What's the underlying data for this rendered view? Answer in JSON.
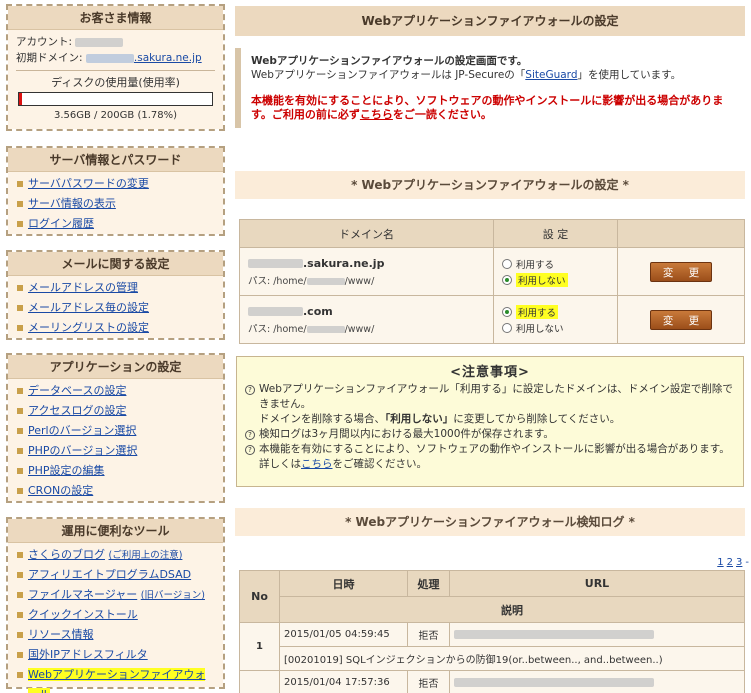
{
  "sidebar": {
    "customer": {
      "title": "お客さま情報",
      "account_label": "アカウント:",
      "domain_label": "初期ドメイン:",
      "domain_suffix": ".sakura.ne.jp",
      "disk_title": "ディスクの使用量(使用率)",
      "disk_usage": "3.56GB / 200GB (1.78%)",
      "disk_percent": 1.78
    },
    "server": {
      "title": "サーバ情報とパスワード",
      "items": [
        "サーバパスワードの変更",
        "サーバ情報の表示",
        "ログイン履歴"
      ]
    },
    "mail": {
      "title": "メールに関する設定",
      "items": [
        "メールアドレスの管理",
        "メールアドレス毎の設定",
        "メーリングリストの設定"
      ]
    },
    "app": {
      "title": "アプリケーションの設定",
      "items": [
        "データベースの設定",
        "アクセスログの設定",
        "Perlのバージョン選択",
        "PHPのバージョン選択",
        "PHP設定の編集",
        "CRONの設定"
      ]
    },
    "tools": {
      "title": "運用に便利なツール",
      "items": [
        "さくらのブログ",
        "アフィリエイトプログラムDSAD",
        "ファイルマネージャー",
        "クイックインストール",
        "リソース情報",
        "国外IPアドレスフィルタ",
        "Webアプリケーションファイアウォール"
      ],
      "blog_note": "(ご利用上の注意)",
      "fm_note": "(旧バージョン)"
    }
  },
  "main": {
    "header": "Webアプリケーションファイアウォールの設定",
    "intro_bold": "Webアプリケーションファイアウォールの設定画面です。",
    "intro_text_a": "Webアプリケーションファイアウォールは JP-Secureの「",
    "intro_link": "SiteGuard",
    "intro_text_b": "」を使用しています。",
    "warn_a": "本機能を有効にすることにより、ソフトウェアの動作やインストールに影響が出る場合があります。ご利用の前に必ず",
    "warn_link": "こちら",
    "warn_b": "をご一読ください。",
    "settings_section": "* Webアプリケーションファイアウォールの設定 *",
    "table_headers": {
      "domain": "ドメイン名",
      "setting": "設 定"
    },
    "rows": [
      {
        "domain_suffix": ".sakura.ne.jp",
        "path_prefix": "パス: /home/",
        "path_suffix": "/www/",
        "opt_use": "利用する",
        "opt_nouse": "利用しない",
        "selected": "nouse",
        "button": "変 更"
      },
      {
        "domain_suffix": ".com",
        "path_prefix": "パス: /home/",
        "path_suffix": "/www/",
        "opt_use": "利用する",
        "opt_nouse": "利用しない",
        "selected": "use",
        "button": "変 更"
      }
    ],
    "notice": {
      "title": "<注意事項>",
      "l1": "Webアプリケーションファイアウォール「利用する」に設定したドメインは、ドメイン設定で削除できません。",
      "l1b_a": "ドメインを削除する場合、",
      "l1b_bold": "「利用しない」",
      "l1b_b": "に変更してから削除してください。",
      "l2": "検知ログは3ヶ月間以内における最大1000件が保存されます。",
      "l3": "本機能を有効にすることにより、ソフトウェアの動作やインストールに影響が出る場合があります。詳しくは",
      "l3_link": "こちら",
      "l3_b": "をご確認ください。"
    },
    "log_section": "* Webアプリケーションファイアウォール検知ログ *",
    "pager": [
      "1",
      "2",
      "3",
      "-"
    ],
    "log_headers": {
      "no": "No",
      "datetime": "日時",
      "action": "処理",
      "url": "URL",
      "desc": "説明"
    },
    "logs": [
      {
        "no": "1",
        "datetime": "2015/01/05 04:59:45",
        "action": "拒否",
        "desc": "[00201019] SQLインジェクションからの防御19(or..between.., and..between..)"
      },
      {
        "datetime": "2015/01/04 17:57:36",
        "action": "拒否"
      }
    ]
  }
}
